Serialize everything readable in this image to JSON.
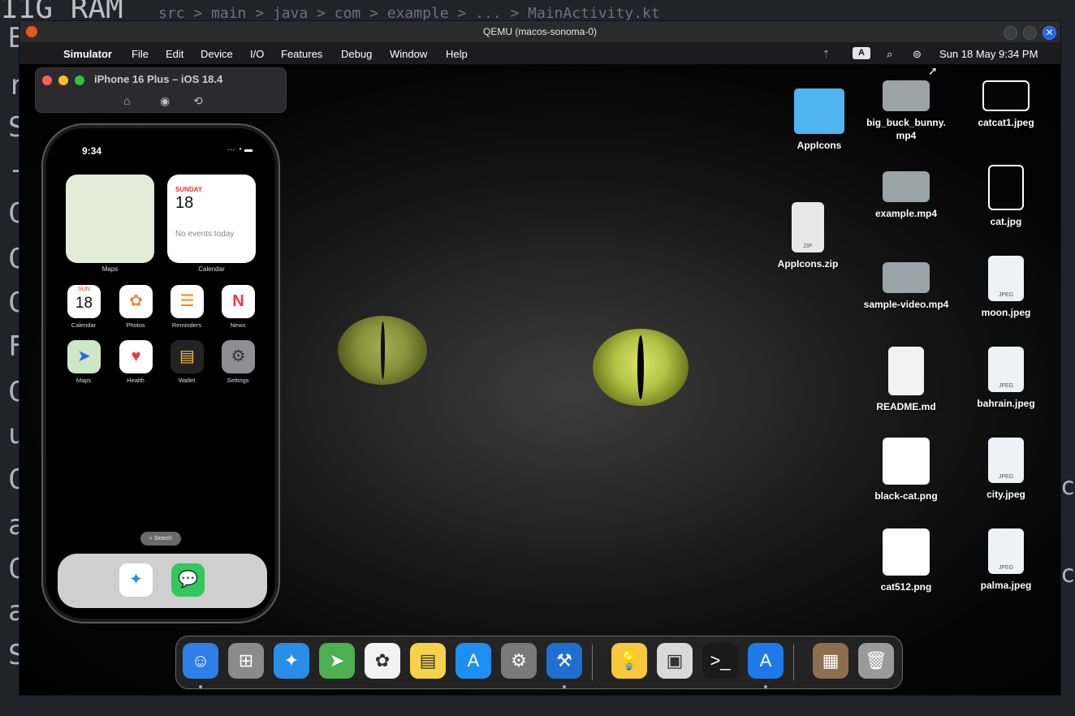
{
  "background": {
    "title": "11G RAM",
    "path": "src > main > java > com > example > ... > MainActivity.kt",
    "left_chars": [
      "B",
      "r",
      "S",
      "-",
      "C",
      "C",
      "C",
      "F",
      "C",
      "u",
      "C",
      "a-",
      "C",
      "a-",
      "S"
    ],
    "right_chars": [
      "c",
      "c"
    ]
  },
  "qemu": {
    "title": "QEMU (macos-sonoma-0)",
    "close_glyph": "✕"
  },
  "menubar": {
    "apple_glyph": "",
    "app": "Simulator",
    "items": [
      "File",
      "Edit",
      "Device",
      "I/O",
      "Features",
      "Debug",
      "Window",
      "Help"
    ],
    "input_badge": "A",
    "datetime": "Sun 18 May  9:34 PM"
  },
  "simulator": {
    "title": "iPhone 16 Plus – iOS 18.4",
    "home_glyph": "⌂",
    "screenshot_glyph": "◉",
    "rotate_glyph": "⟲"
  },
  "phone": {
    "time": "9:34",
    "status": "···  ◔  ▬",
    "widgets": {
      "maps_label": "Maps",
      "calendar_day": "SUNDAY",
      "calendar_date": "18",
      "calendar_events": "No events today",
      "calendar_label": "Calendar"
    },
    "apps_row1": [
      {
        "label": "Calendar",
        "glyph": "18",
        "sub": "SUN"
      },
      {
        "label": "Photos",
        "glyph": "✿"
      },
      {
        "label": "Reminders",
        "glyph": "☰"
      },
      {
        "label": "News",
        "glyph": "N"
      }
    ],
    "apps_row2": [
      {
        "label": "Maps",
        "glyph": "➤"
      },
      {
        "label": "Health",
        "glyph": "♥"
      },
      {
        "label": "Wallet",
        "glyph": "▤"
      },
      {
        "label": "Settings",
        "glyph": "⚙"
      }
    ],
    "search_label": "⌕ Search",
    "dock": [
      {
        "name": "Safari",
        "glyph": "✦"
      },
      {
        "name": "Messages",
        "glyph": "💬"
      }
    ]
  },
  "desktop_files": [
    {
      "label": "AppIcons"
    },
    {
      "label": "AppIcons.zip",
      "sub": "ZIP"
    },
    {
      "label": "big_buck_bunny.\nmp4"
    },
    {
      "label": "catcat1.jpeg"
    },
    {
      "label": "example.mp4"
    },
    {
      "label": "cat.jpg"
    },
    {
      "label": "sample-video.mp4"
    },
    {
      "label": "moon.jpeg",
      "sub": "JPEG"
    },
    {
      "label": "README.md"
    },
    {
      "label": "bahrain.jpeg",
      "sub": "JPEG"
    },
    {
      "label": "black-cat.png"
    },
    {
      "label": "city.jpeg",
      "sub": "JPEG"
    },
    {
      "label": "cat512.png"
    },
    {
      "label": "palma.jpeg",
      "sub": "JPEG"
    }
  ],
  "dock": [
    {
      "name": "Finder",
      "glyph": "☺",
      "color": "#2f7fe8"
    },
    {
      "name": "Launchpad",
      "glyph": "⊞",
      "color": "#8b8b8b"
    },
    {
      "name": "Safari",
      "glyph": "✦",
      "color": "#2a8ee8"
    },
    {
      "name": "Maps",
      "glyph": "➤",
      "color": "#4caf50"
    },
    {
      "name": "Photos",
      "glyph": "✿",
      "color": "#f2f2f2"
    },
    {
      "name": "Notes",
      "glyph": "▤",
      "color": "#f5d24a"
    },
    {
      "name": "App Store",
      "glyph": "A",
      "color": "#1e8ff2"
    },
    {
      "name": "System Settings",
      "glyph": "⚙",
      "color": "#7a7a7a"
    },
    {
      "name": "Xcode",
      "glyph": "⚒",
      "color": "#1f6fd1"
    },
    {
      "name": "Tips",
      "glyph": "💡",
      "color": "#f6c83c"
    },
    {
      "name": "Preview",
      "glyph": "▣",
      "color": "#d9d9d9"
    },
    {
      "name": "Terminal",
      "glyph": ">_",
      "color": "#1a1a1a"
    },
    {
      "name": "Simulator",
      "glyph": "A",
      "color": "#1e7ae8"
    },
    {
      "name": "Archive Utility",
      "glyph": "▦",
      "color": "#8d6f4e"
    },
    {
      "name": "Trash",
      "glyph": "🗑",
      "color": "#9a9a9a"
    }
  ]
}
